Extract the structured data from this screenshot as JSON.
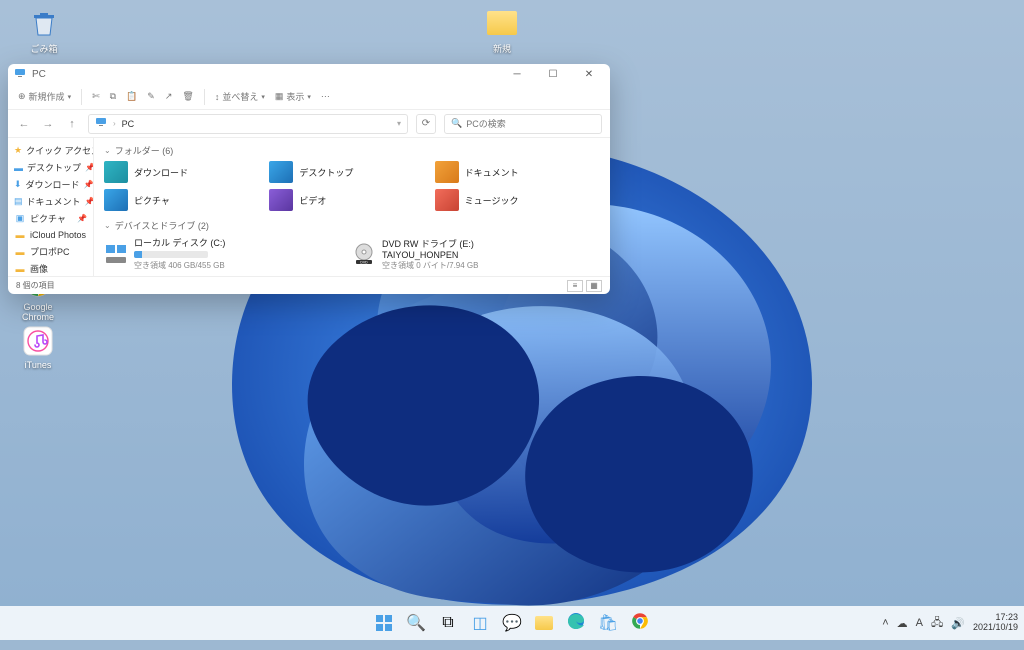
{
  "desktop": {
    "icons": [
      {
        "name": "recycle-bin",
        "label": "ごみ箱"
      },
      {
        "name": "folder-top",
        "label": "新規"
      },
      {
        "name": "google-chrome",
        "label": "Google Chrome"
      },
      {
        "name": "itunes",
        "label": "iTunes"
      }
    ]
  },
  "explorer": {
    "title": "PC",
    "toolbar": {
      "new": "新規作成",
      "sort": "並べ替え",
      "view": "表示"
    },
    "breadcrumb": "PC",
    "search_placeholder": "PCの検索",
    "status": "8 個の項目",
    "sidebar": [
      {
        "icon": "star",
        "label": "クイック アクセス"
      },
      {
        "icon": "desktop",
        "label": "デスクトップ",
        "pinned": true
      },
      {
        "icon": "download",
        "label": "ダウンロード",
        "pinned": true
      },
      {
        "icon": "document",
        "label": "ドキュメント",
        "pinned": true
      },
      {
        "icon": "picture",
        "label": "ピクチャ",
        "pinned": true
      },
      {
        "icon": "folder",
        "label": "iCloud Photos"
      },
      {
        "icon": "folder",
        "label": "プロポPC"
      },
      {
        "icon": "folder",
        "label": "画像"
      }
    ],
    "sections": {
      "folders_title": "フォルダー (6)",
      "drives_title": "デバイスとドライブ (2)",
      "folders": [
        {
          "label": "ダウンロード",
          "cls": "fc-dl"
        },
        {
          "label": "デスクトップ",
          "cls": "fc-desk"
        },
        {
          "label": "ドキュメント",
          "cls": "fc-doc"
        },
        {
          "label": "ピクチャ",
          "cls": "fc-pic"
        },
        {
          "label": "ビデオ",
          "cls": "fc-vid"
        },
        {
          "label": "ミュージック",
          "cls": "fc-mus"
        }
      ],
      "drives": [
        {
          "label": "ローカル ディスク (C:)",
          "sub": "空き領域 406 GB/455 GB",
          "fill": 11
        },
        {
          "label": "DVD RW ドライブ (E:)",
          "label2": "TAIYOU_HONPEN",
          "sub": "空き領域 0 バイト/7.94 GB"
        }
      ]
    }
  },
  "taskbar": {
    "time": "17:23",
    "date": "2021/10/19"
  }
}
